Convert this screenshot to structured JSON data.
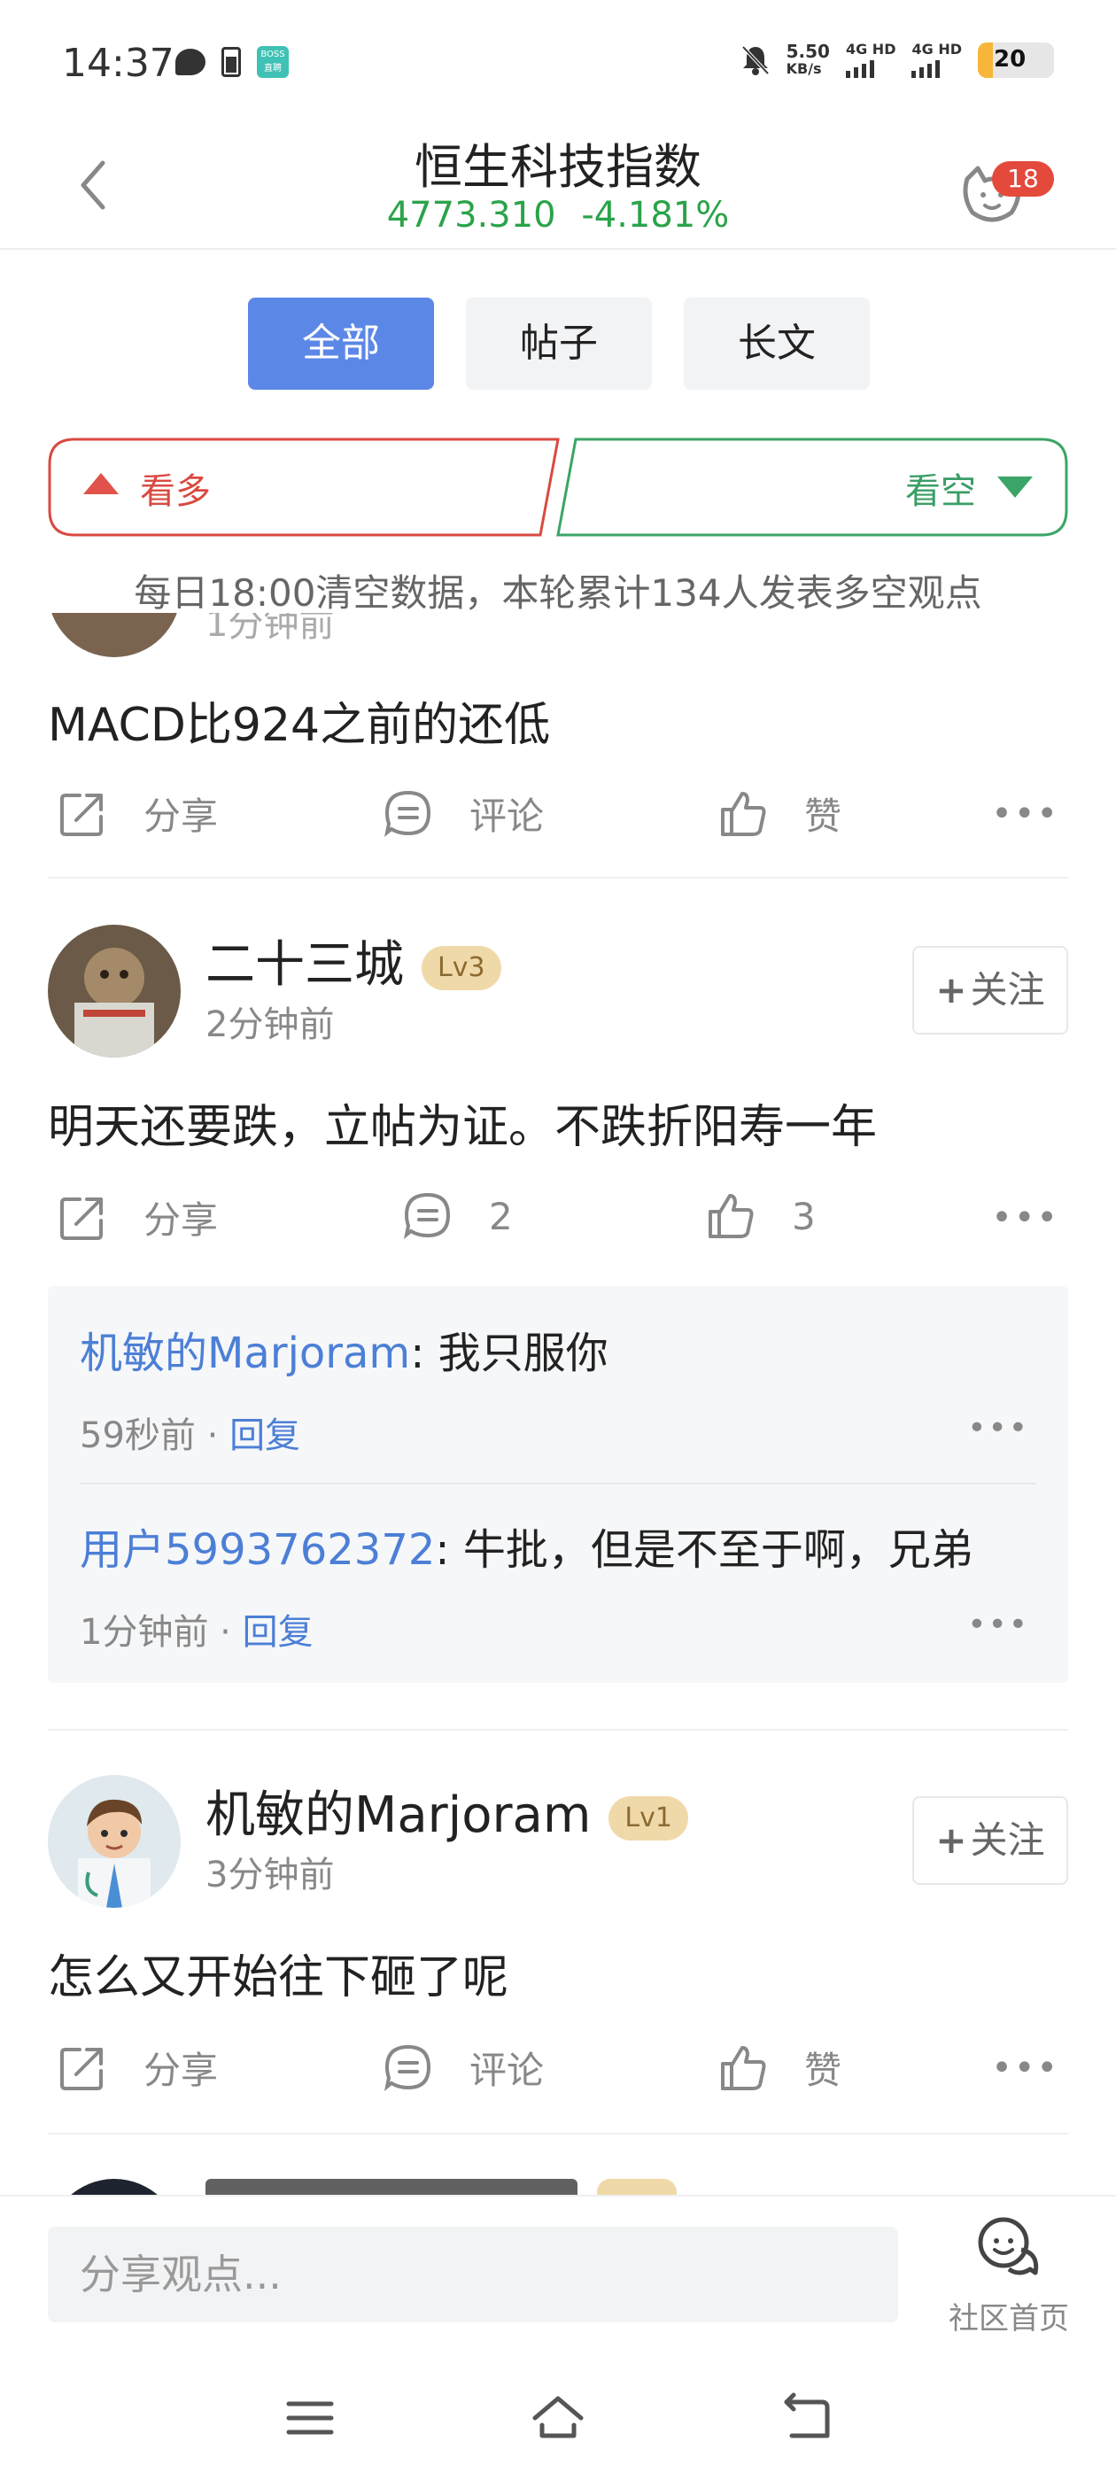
{
  "status_bar": {
    "time": "14:37",
    "boss_label": "BOSS 直聘",
    "speed": "5.50",
    "speed_unit": "KB/s",
    "signal1": "4G HD",
    "signal2": "4G HD",
    "battery": "20"
  },
  "header": {
    "title": "恒生科技指数",
    "price": "4773.310",
    "change": "-4.181%",
    "badge_count": "18"
  },
  "tabs": [
    {
      "label": "全部",
      "active": true
    },
    {
      "label": "帖子",
      "active": false
    },
    {
      "label": "长文",
      "active": false
    }
  ],
  "sentiment": {
    "bull_label": "看多",
    "bear_label": "看空",
    "notice": "每日18:00清空数据，本轮累计134人发表多空观点"
  },
  "posts": [
    {
      "time_ago": "1分钟前",
      "body": "MACD比924之前的还低",
      "share": "分享",
      "comment": "评论",
      "like": "赞"
    },
    {
      "username": "二十三城",
      "level": "Lv3",
      "time_ago": "2分钟前",
      "follow": "关注",
      "body": "明天还要跌，立帖为证。不跌折阳寿一年",
      "share": "分享",
      "comment": "2",
      "like": "3",
      "replies": [
        {
          "user": "机敏的Marjoram",
          "text": ": 我只服你",
          "time": "59秒前",
          "reply": "回复"
        },
        {
          "user": "用户5993762372",
          "text": ": 牛批，但是不至于啊，兄弟",
          "time": "1分钟前",
          "reply": "回复"
        }
      ]
    },
    {
      "username": "机敏的Marjoram",
      "level": "Lv1",
      "time_ago": "3分钟前",
      "follow": "关注",
      "body": "怎么又开始往下砸了呢",
      "share": "分享",
      "comment": "评论",
      "like": "赞"
    }
  ],
  "bottom": {
    "input_placeholder": "分享观点...",
    "community": "社区首页"
  },
  "colors": {
    "accent": "#5b87e6",
    "down_green": "#2ba34a",
    "bull_red": "#d94a41",
    "link_blue": "#4c7fd6"
  }
}
